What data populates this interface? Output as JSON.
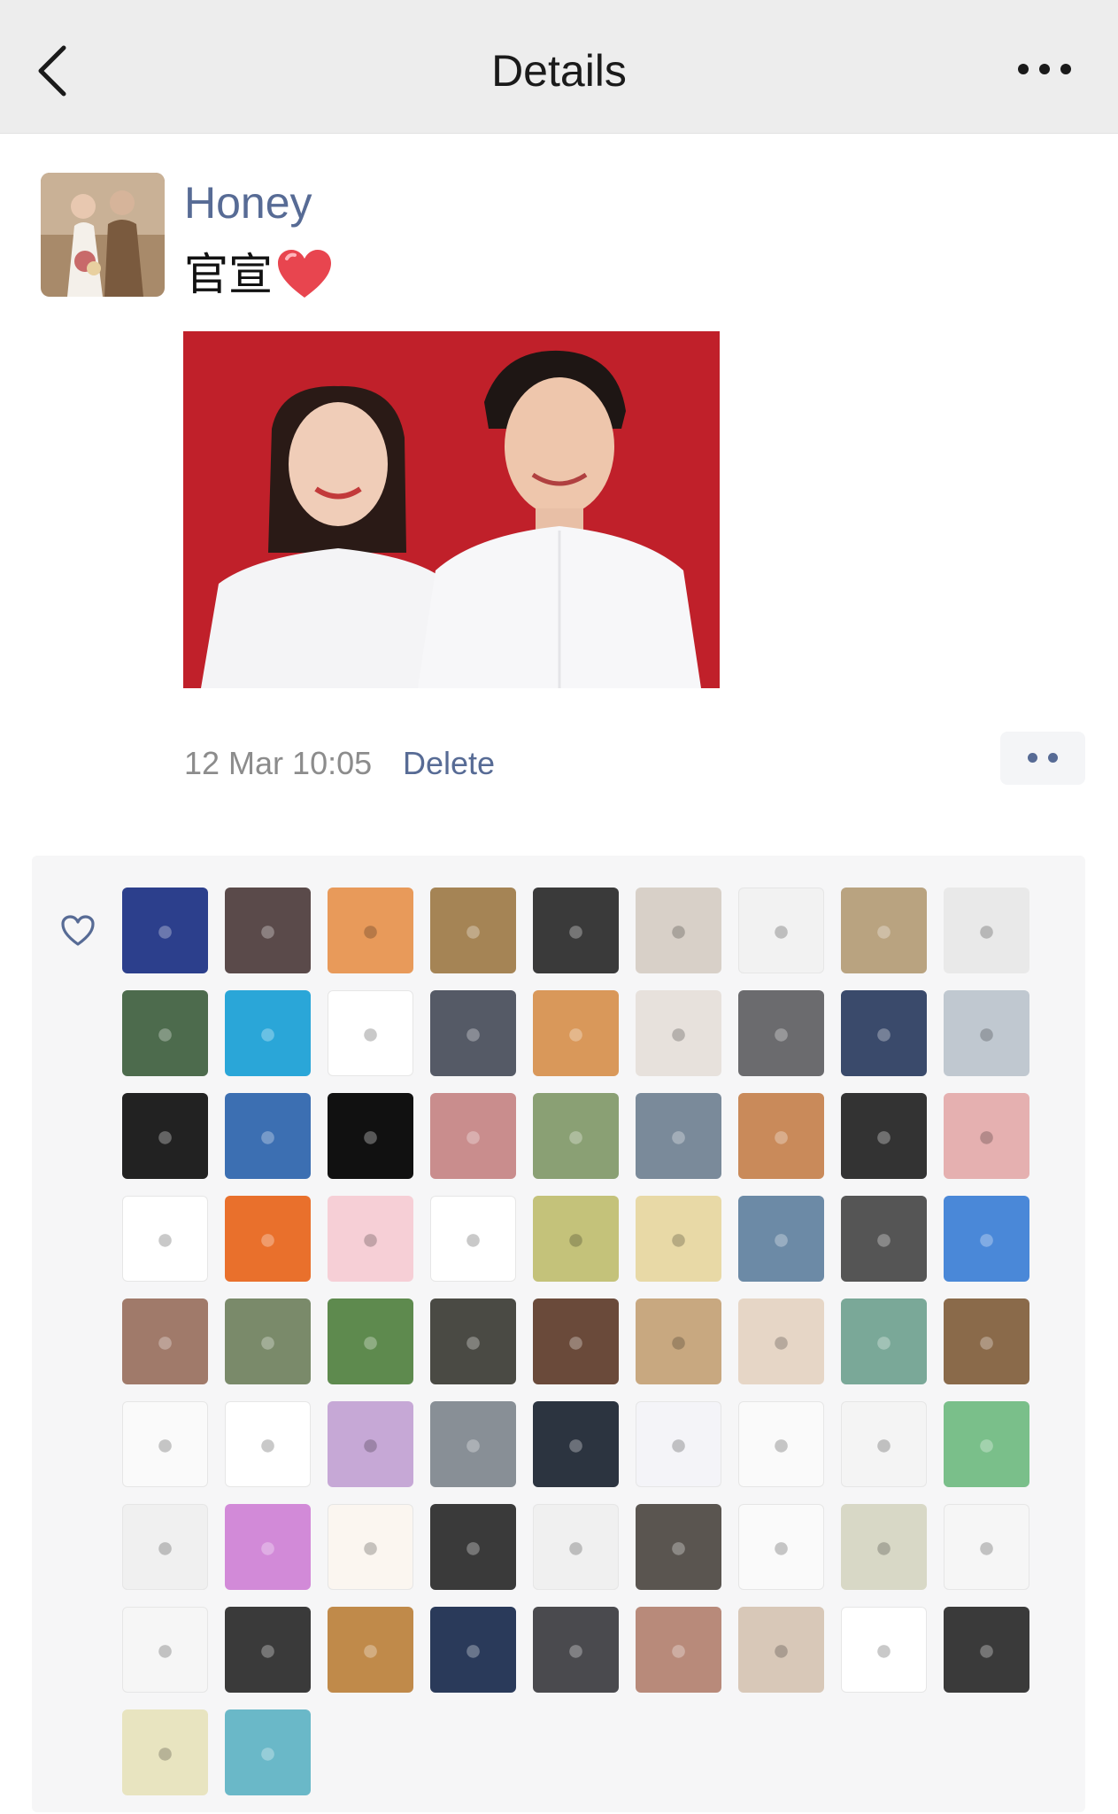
{
  "navbar": {
    "title": "Details",
    "back_icon": "chevron-left-icon",
    "more_icon": "more-horizontal-icon"
  },
  "post": {
    "author": "Honey",
    "text": "官宣",
    "emoji": "red-heart-emoji",
    "timestamp": "12 Mar 10:05",
    "delete_label": "Delete",
    "action_icon": "comment-like-menu-icon"
  },
  "likes": {
    "icon": "heart-outline-icon",
    "count": 74,
    "avatar_colors": [
      "#2c3f8c",
      "#5a4a4a",
      "#e89a5a",
      "#a58455",
      "#3a3a3a",
      "#d8d0c8",
      "#f2f2f2",
      "#b9a380",
      "#e9e9e9",
      "#4d6b4d",
      "#2aa6d8",
      "#ffffff",
      "#555a66",
      "#d9985a",
      "#e7e1dc",
      "#6b6b6e",
      "#3a4a6b",
      "#c0c8d0",
      "#222222",
      "#3c6fb2",
      "#111111",
      "#c98d8d",
      "#8aa074",
      "#7a8a9a",
      "#c98a5a",
      "#333333",
      "#e5b0b0",
      "#ffffff",
      "#e9702c",
      "#f6cfd6",
      "#ffffff",
      "#c4c27a",
      "#e8d9a6",
      "#6c8aa6",
      "#555555",
      "#4a88d8",
      "#a07a6a",
      "#7a8a6a",
      "#5e8a4e",
      "#4a4a44",
      "#6a4a3a",
      "#c8a880",
      "#e6d6c6",
      "#7aa898",
      "#8a6a4a",
      "#fafafa",
      "#ffffff",
      "#c6a8d6",
      "#888f96",
      "#2c3440",
      "#f4f4f8",
      "#fafafa",
      "#f4f4f4",
      "#7abf8a",
      "#f0f0f0",
      "#d28ad8",
      "#fbf6f0",
      "#3a3a3a",
      "#f0f0f0",
      "#5a5550",
      "#fafafa",
      "#d8d8c6",
      "#f6f6f6",
      "#f6f6f6",
      "#3a3a3a",
      "#c08a4a",
      "#2a3a5a",
      "#4a4a4e",
      "#b88a7a",
      "#d8c8b8",
      "#ffffff",
      "#3a3a3a",
      "#e8e4c0",
      "#6ab8c8"
    ]
  }
}
